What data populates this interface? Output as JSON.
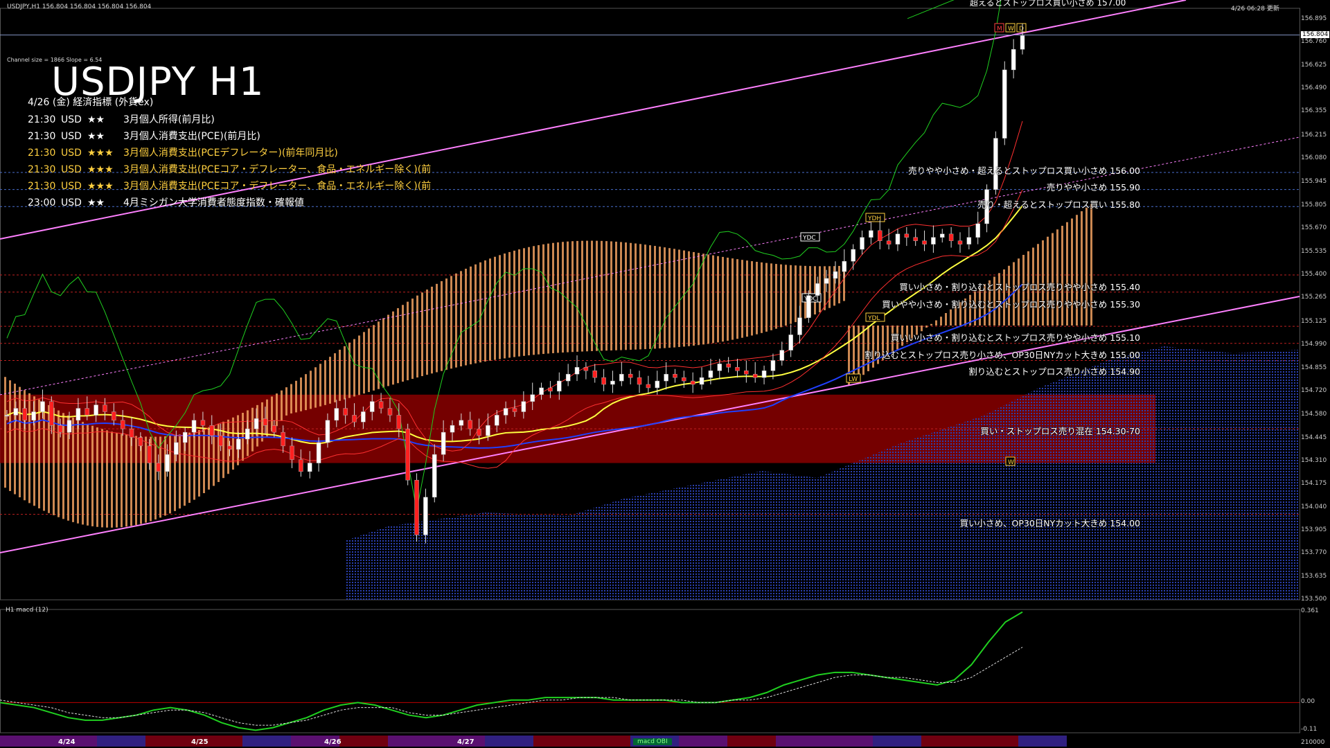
{
  "header": {
    "symbol_line": "USDJPY,H1  156.804 156.804 156.804 156.804",
    "top_note": "超えるとストップロス買い小さめ 157.00",
    "updated": "4/26 06:28 更新"
  },
  "channel_info": "Channel size = 1866  Slope = 6.54",
  "title": "USDJPY H1",
  "calendar": {
    "date_label": "4/26 (金) 経済指標 (外貨ex)",
    "events": [
      {
        "time": "21:30",
        "currency": "USD",
        "stars": "★★",
        "name": "3月個人所得(前月比)",
        "color": "#ffffff"
      },
      {
        "time": "21:30",
        "currency": "USD",
        "stars": "★★",
        "name": "3月個人消費支出(PCE)(前月比)",
        "color": "#ffffff"
      },
      {
        "time": "21:30",
        "currency": "USD",
        "stars": "★★★",
        "name": "3月個人消費支出(PCEデフレーター)(前年同月比)",
        "color": "#ffd040"
      },
      {
        "time": "21:30",
        "currency": "USD",
        "stars": "★★★",
        "name": "3月個人消費支出(PCEコア・デフレーター、食品・エネルギー除く)(前",
        "color": "#ffd040"
      },
      {
        "time": "21:30",
        "currency": "USD",
        "stars": "★★★",
        "name": "3月個人消費支出(PCEコア・デフレーター、食品・エネルギー除く)(前",
        "color": "#ffd040"
      },
      {
        "time": "23:00",
        "currency": "USD",
        "stars": "★★",
        "name": "4月ミシガン大学消費者態度指数・確報値",
        "color": "#ffffff"
      }
    ]
  },
  "annotations": [
    {
      "text": "売りやや小さめ・超えるとストップロス買い小さめ 156.00",
      "price": 156.0
    },
    {
      "text": "売りやや小さめ 155.90",
      "price": 155.9
    },
    {
      "text": "売り・超えるとストップロス買い 155.80",
      "price": 155.8
    },
    {
      "text": "買い小さめ・割り込むとストップロス売りやや小さめ 155.40",
      "price": 155.4
    },
    {
      "text": "買いやや小さめ・割り込むとストップロス売りやや小さめ 155.30",
      "price": 155.3
    },
    {
      "text": "買いい小さめ・割り込むとストップロス売りやや小さめ 155.10",
      "price": 155.1
    },
    {
      "text": "割り込むとストップロス売り小さめ、OP30日NYカット大きめ 155.00",
      "price": 155.0
    },
    {
      "text": "割り込むとストップロス売り小さめ 154.90",
      "price": 154.9
    },
    {
      "text": "買い・ストップロス売り混在 154.30-70",
      "price": 154.5
    },
    {
      "text": "買い小さめ、OP30日NYカット大きめ 154.00",
      "price": 154.0
    }
  ],
  "markers": {
    "m": "M",
    "w": "W",
    "d": "D",
    "ydh": "YDH",
    "ydl": "YDL",
    "ydc": "YDC",
    "lw": "LW"
  },
  "macd_label": "H1  macd (12)",
  "macd_tag": "macd OBI",
  "chart_data": {
    "type": "line",
    "title": "USDJPY H1",
    "ylim": [
      153.5,
      156.96
    ],
    "price_labels": [
      "156.895",
      "156.760",
      "156.625",
      "156.490",
      "156.355",
      "156.215",
      "156.080",
      "155.945",
      "155.805",
      "155.670",
      "155.535",
      "155.400",
      "155.265",
      "155.125",
      "154.990",
      "154.855",
      "154.720",
      "154.580",
      "154.445",
      "154.310",
      "154.175",
      "154.040",
      "153.905",
      "153.770",
      "153.635",
      "153.500"
    ],
    "current_price": "156.804",
    "macd_labels": [
      "0.361",
      "0.00",
      "-0.11"
    ],
    "macd_ylim": [
      -0.12,
      0.37
    ],
    "date_labels": [
      "4/24",
      "4/25",
      "4/26",
      "4/27"
    ],
    "bottom_right_label": "210000",
    "zone": {
      "low": 154.3,
      "high": 154.7
    },
    "price_series": [
      154.58,
      154.62,
      154.55,
      154.6,
      154.66,
      154.52,
      154.48,
      154.55,
      154.62,
      154.58,
      154.64,
      154.6,
      154.55,
      154.5,
      154.45,
      154.4,
      154.3,
      154.25,
      154.35,
      154.42,
      154.48,
      154.55,
      154.52,
      154.46,
      154.4,
      154.38,
      154.44,
      154.5,
      154.56,
      154.52,
      154.48,
      154.4,
      154.32,
      154.25,
      154.3,
      154.42,
      154.55,
      154.62,
      154.58,
      154.54,
      154.6,
      154.66,
      154.62,
      154.58,
      154.5,
      154.2,
      153.88,
      154.1,
      154.35,
      154.48,
      154.52,
      154.55,
      154.5,
      154.46,
      154.52,
      154.58,
      154.62,
      154.6,
      154.66,
      154.7,
      154.74,
      154.72,
      154.78,
      154.82,
      154.86,
      154.84,
      154.8,
      154.76,
      154.78,
      154.82,
      154.8,
      154.76,
      154.74,
      154.78,
      154.82,
      154.8,
      154.78,
      154.76,
      154.8,
      154.84,
      154.88,
      154.86,
      154.84,
      154.82,
      154.8,
      154.84,
      154.9,
      154.96,
      155.05,
      155.15,
      155.28,
      155.35,
      155.38,
      155.42,
      155.48,
      155.55,
      155.62,
      155.66,
      155.6,
      155.58,
      155.64,
      155.62,
      155.6,
      155.58,
      155.62,
      155.64,
      155.6,
      155.58,
      155.62,
      155.7,
      155.9,
      156.2,
      156.6,
      156.72,
      156.8
    ],
    "macd_series": [
      0.0,
      -0.01,
      -0.02,
      -0.04,
      -0.06,
      -0.07,
      -0.07,
      -0.06,
      -0.05,
      -0.03,
      -0.02,
      -0.03,
      -0.05,
      -0.08,
      -0.1,
      -0.11,
      -0.1,
      -0.08,
      -0.06,
      -0.03,
      -0.01,
      0.0,
      -0.01,
      -0.03,
      -0.05,
      -0.06,
      -0.05,
      -0.03,
      -0.01,
      0.0,
      0.01,
      0.01,
      0.02,
      0.02,
      0.02,
      0.02,
      0.01,
      0.01,
      0.01,
      0.01,
      0.0,
      0.0,
      0.0,
      0.01,
      0.02,
      0.04,
      0.07,
      0.09,
      0.11,
      0.12,
      0.12,
      0.11,
      0.1,
      0.09,
      0.08,
      0.07,
      0.09,
      0.15,
      0.24,
      0.32,
      0.36
    ],
    "signal_series": [
      0.01,
      0.0,
      -0.01,
      -0.02,
      -0.04,
      -0.05,
      -0.06,
      -0.06,
      -0.05,
      -0.04,
      -0.03,
      -0.03,
      -0.04,
      -0.06,
      -0.08,
      -0.09,
      -0.09,
      -0.08,
      -0.07,
      -0.05,
      -0.03,
      -0.02,
      -0.02,
      -0.02,
      -0.04,
      -0.05,
      -0.05,
      -0.04,
      -0.03,
      -0.02,
      -0.01,
      0.0,
      0.01,
      0.01,
      0.02,
      0.02,
      0.02,
      0.01,
      0.01,
      0.01,
      0.01,
      0.0,
      0.0,
      0.01,
      0.01,
      0.02,
      0.04,
      0.06,
      0.08,
      0.1,
      0.11,
      0.11,
      0.1,
      0.1,
      0.09,
      0.08,
      0.08,
      0.1,
      0.14,
      0.18,
      0.22
    ]
  }
}
